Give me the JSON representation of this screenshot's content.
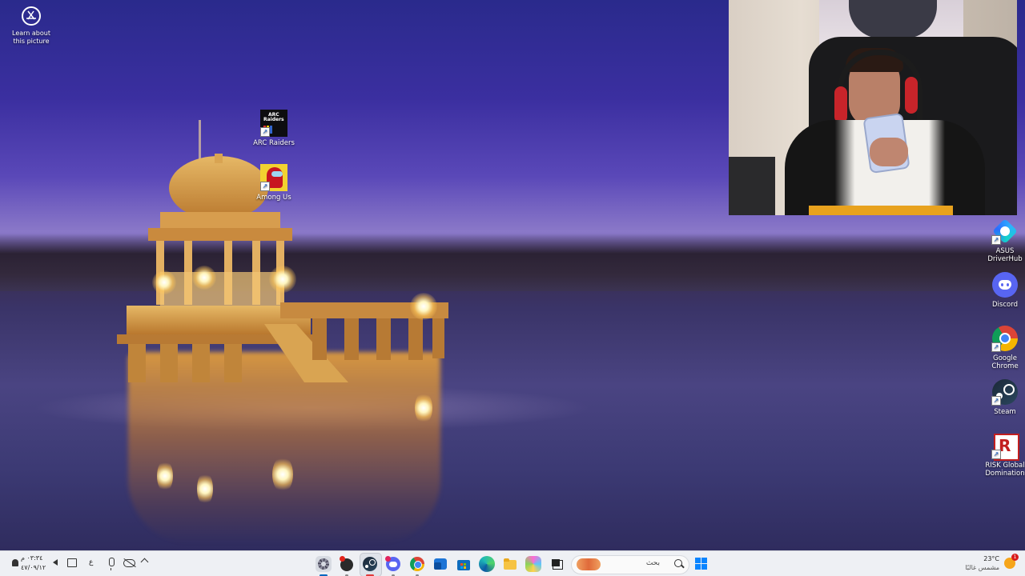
{
  "desktop": {
    "learn_picture": {
      "label": "Learn about this picture",
      "icon": "camera-lens-icon"
    },
    "icons_left": [
      {
        "label": "ARC Raiders",
        "icon": "arc-raiders-icon"
      },
      {
        "label": "Among Us",
        "icon": "among-us-icon"
      }
    ],
    "icons_right": [
      {
        "label": "ASUS DriverHub",
        "icon": "asus-driverhub-icon"
      },
      {
        "label": "Discord",
        "icon": "discord-icon"
      },
      {
        "label": "Google Chrome",
        "icon": "chrome-icon"
      },
      {
        "label": "Steam",
        "icon": "steam-icon"
      },
      {
        "label": "RISK Global Domination",
        "icon": "risk-icon"
      }
    ]
  },
  "taskbar": {
    "weather": {
      "temp": "23°C",
      "condition": "مشمس غالبًا",
      "badge": "1"
    },
    "search_placeholder": "بحث",
    "apps": [
      {
        "name": "settings-app-icon"
      },
      {
        "name": "media-app-icon"
      },
      {
        "name": "steam-app-icon"
      },
      {
        "name": "discord-app-icon"
      },
      {
        "name": "chrome-app-icon"
      },
      {
        "name": "outlook-app-icon"
      },
      {
        "name": "store-app-icon"
      },
      {
        "name": "edge-app-icon"
      },
      {
        "name": "file-explorer-icon"
      },
      {
        "name": "copilot-app-icon"
      },
      {
        "name": "task-view-icon"
      },
      {
        "name": "start-button-icon"
      }
    ],
    "tray": {
      "time": "٠٣:٣٤ م",
      "date": "٤٧/٠٩/١٢",
      "language": "ع"
    }
  },
  "colors": {
    "accent": "#0067c0",
    "taskbar_bg": "#eef0f4"
  }
}
